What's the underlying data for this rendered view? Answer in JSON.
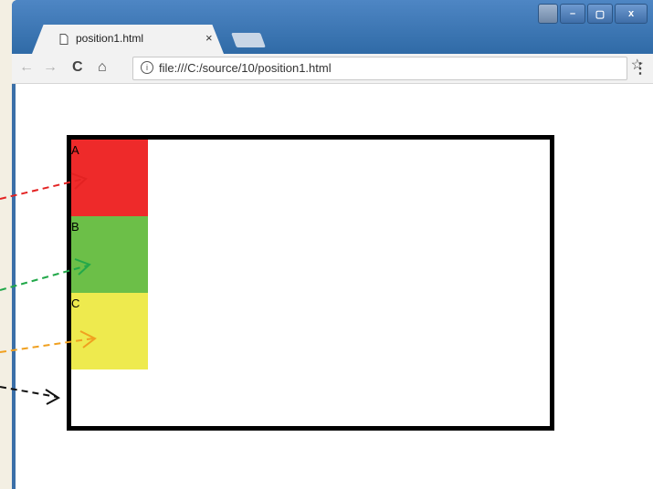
{
  "browser": {
    "tab_title": "position1.html",
    "tab_close": "×",
    "url": "file:///C:/source/10/position1.html",
    "window_controls": [
      "–",
      "▢",
      "x"
    ]
  },
  "toolbar": {
    "back": "←",
    "forward": "→",
    "reload": "C",
    "home": "⌂",
    "info": "i",
    "bookmark": "☆",
    "menu": "⋮"
  },
  "page": {
    "boxes": [
      {
        "label": "A",
        "color": "#ee2a2a"
      },
      {
        "label": "B",
        "color": "#6cbf48"
      },
      {
        "label": "C",
        "color": "#eeea4e"
      }
    ]
  },
  "arrow_colors": [
    "#e32222",
    "#22a84a",
    "#f0a020",
    "#111111"
  ]
}
